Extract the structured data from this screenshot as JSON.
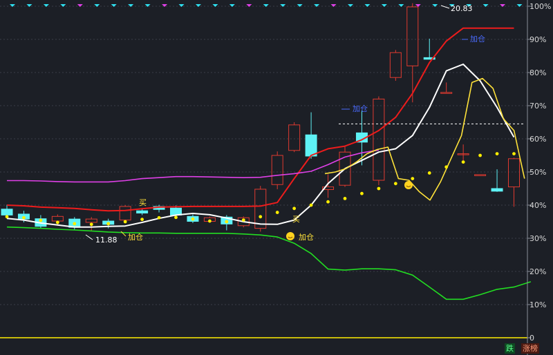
{
  "chart_data": {
    "type": "line",
    "title": "",
    "xlabel": "",
    "ylabel": "",
    "y_axis": {
      "ylim": [
        0,
        100
      ],
      "ticks": [
        "100%",
        "90%",
        "80%",
        "70%",
        "60%",
        "50%",
        "40%",
        "30%",
        "20%",
        "10%",
        "0"
      ]
    },
    "price_axis": {
      "ylim": [
        10.94,
        21.1
      ]
    },
    "grid": "horizontal dotted",
    "reference_line": {
      "y": 64.5,
      "style": "dashed",
      "color": "#ffffff"
    },
    "candles": [
      {
        "o": 38.8,
        "c": 37.0,
        "h": 40.1,
        "l": 36.0
      },
      {
        "o": 37.3,
        "c": 35.8,
        "h": 38.3,
        "l": 34.8
      },
      {
        "o": 35.9,
        "c": 33.6,
        "h": 37.0,
        "l": 33.0
      },
      {
        "o": 35.2,
        "c": 36.6,
        "h": 37.2,
        "l": 33.8
      },
      {
        "o": 35.8,
        "c": 33.3,
        "h": 36.4,
        "l": 32.6
      },
      {
        "o": 34.8,
        "c": 35.8,
        "h": 36.4,
        "l": 32.2
      },
      {
        "o": 35.2,
        "c": 34.2,
        "h": 35.9,
        "l": 33.0
      },
      {
        "o": 35.5,
        "c": 39.6,
        "h": 40.0,
        "l": 34.8
      },
      {
        "o": 38.3,
        "c": 37.6,
        "h": 39.1,
        "l": 37.0
      },
      {
        "o": 39.6,
        "c": 38.7,
        "h": 40.1,
        "l": 37.8
      },
      {
        "o": 39.1,
        "c": 37.0,
        "h": 39.9,
        "l": 36.4
      },
      {
        "o": 36.6,
        "c": 35.1,
        "h": 37.2,
        "l": 34.6
      },
      {
        "o": 35.1,
        "c": 36.2,
        "h": 36.6,
        "l": 34.8
      },
      {
        "o": 36.4,
        "c": 34.3,
        "h": 37.0,
        "l": 32.4
      },
      {
        "o": 33.8,
        "c": 36.2,
        "h": 36.6,
        "l": 33.3
      },
      {
        "o": 33.0,
        "c": 44.8,
        "h": 45.8,
        "l": 32.0
      },
      {
        "o": 46.2,
        "c": 55.0,
        "h": 56.2,
        "l": 44.8
      },
      {
        "o": 56.5,
        "c": 64.2,
        "h": 65.0,
        "l": 56.0
      },
      {
        "o": 61.2,
        "c": 54.8,
        "h": 68.0,
        "l": 54.0
      },
      {
        "o": 44.7,
        "c": 45.5,
        "h": 49.3,
        "l": 42.2
      },
      {
        "o": 46.0,
        "c": 56.0,
        "h": 58.0,
        "l": 45.5
      },
      {
        "o": 61.8,
        "c": 59.0,
        "h": 68.5,
        "l": 52.0
      },
      {
        "o": 47.5,
        "c": 72.0,
        "h": 72.8,
        "l": 46.0
      },
      {
        "o": 78.5,
        "c": 86.0,
        "h": 86.8,
        "l": 77.5
      },
      {
        "o": 82.0,
        "c": 99.8,
        "h": 100.9,
        "l": 71.0
      },
      {
        "o": 84.5,
        "c": 84.0,
        "h": 90.2,
        "l": 84.0
      },
      {
        "o": 74.0,
        "c": 74.0,
        "h": 77.0,
        "l": 74.0
      },
      {
        "o": 55.5,
        "c": 55.5,
        "h": 58.3,
        "l": 53.5
      },
      {
        "o": 49.2,
        "c": 49.2,
        "h": 49.2,
        "l": 49.2
      },
      {
        "o": 45.0,
        "c": 44.2,
        "h": 50.8,
        "l": 44.0
      },
      {
        "o": 45.5,
        "c": 54.0,
        "h": 54.3,
        "l": 39.5
      }
    ],
    "series": [
      {
        "key": "red",
        "color": "#ee1c1c",
        "values": [
          40.0,
          39.8,
          39.4,
          39.2,
          39.0,
          38.6,
          38.3,
          38.4,
          38.9,
          39.4,
          39.5,
          39.6,
          39.6,
          39.6,
          39.6,
          39.7,
          40.8,
          48.0,
          55.0,
          57.0,
          57.8,
          59.7,
          62.5,
          66.5,
          73.7,
          83.0,
          89.5,
          93.4,
          93.4,
          93.4,
          93.4
        ]
      },
      {
        "key": "magenta",
        "color": "#e040e8",
        "values": [
          47.4,
          47.4,
          47.3,
          47.1,
          47.0,
          47.0,
          47.0,
          47.4,
          48.0,
          48.3,
          48.6,
          48.6,
          48.5,
          48.4,
          48.3,
          48.4,
          49.0,
          49.5,
          50.2,
          52.2,
          54.5,
          55.8,
          56.6
        ]
      },
      {
        "key": "white",
        "color": "#ffffff",
        "values": [
          36.0,
          35.5,
          34.6,
          34.0,
          33.4,
          33.4,
          33.6,
          33.7,
          34.8,
          36.0,
          37.0,
          37.5,
          37.1,
          36.1,
          35.0,
          34.3,
          34.2,
          35.5,
          40.0,
          46.5,
          51.0,
          53.5,
          56.0,
          57.0,
          61.0,
          69.5,
          80.5,
          82.5,
          77.5,
          69.5,
          60.5
        ]
      },
      {
        "key": "green",
        "color": "#22dd22",
        "values": [
          33.4,
          33.2,
          33.0,
          32.7,
          32.5,
          32.2,
          31.9,
          31.7,
          31.6,
          31.6,
          31.5,
          31.5,
          31.5,
          31.5,
          31.3,
          31.0,
          30.4,
          28.5,
          25.4,
          20.7,
          20.4,
          20.8,
          20.8,
          20.5,
          18.9,
          15.3,
          11.6,
          11.6,
          13.0,
          14.6,
          15.3,
          16.9
        ]
      },
      {
        "key": "yellow",
        "color": "#ffe23a",
        "values": [
          49.5,
          50.0,
          51.0,
          53.0,
          55.5,
          56.8,
          57.5,
          48.0,
          47.5,
          44.0,
          41.5,
          47.0,
          54.0,
          61.0,
          77.0,
          78.2,
          75.2,
          66.0,
          62.5,
          48.0
        ]
      },
      {
        "key": "dots",
        "color": "#ffee00",
        "values": [
          36.5,
          36.2,
          35.4,
          34.8,
          34.4,
          34.2,
          34.4,
          35.0,
          35.7,
          36.2,
          36.3,
          35.8,
          35.2,
          35.0,
          35.5,
          36.5,
          37.8,
          39.0,
          40.0,
          41.0,
          42.0,
          43.5,
          45.0,
          46.5,
          48.0,
          49.7,
          51.5,
          53.0,
          55.0,
          55.5,
          55.5
        ]
      }
    ],
    "annotations": [
      {
        "text": "20.83",
        "kind": "price_high"
      },
      {
        "text": "11.88",
        "kind": "price_low"
      },
      {
        "text": "买",
        "kind": "signal"
      },
      {
        "text": "买",
        "kind": "signal"
      },
      {
        "text": "加仓",
        "kind": "signal"
      },
      {
        "text": "加仓",
        "kind": "signal"
      },
      {
        "text": "加仓",
        "kind": "marker"
      },
      {
        "text": "加仓",
        "kind": "marker"
      },
      {
        "text": "加仓",
        "kind": "marker"
      }
    ]
  },
  "ui": {
    "badge_down": "跌",
    "badge_up": "涨榜"
  }
}
